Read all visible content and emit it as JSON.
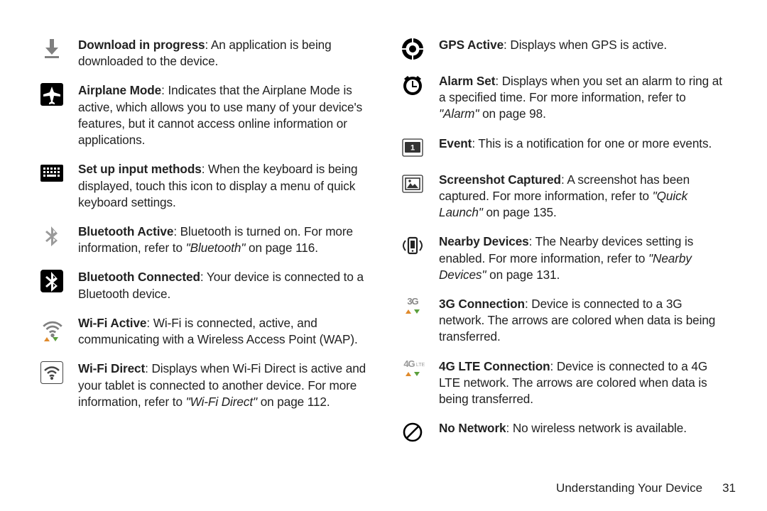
{
  "left": [
    {
      "icon": "download",
      "title": "Download in progress",
      "text": ": An application is being downloaded to the device."
    },
    {
      "icon": "airplane",
      "title": "Airplane Mode",
      "text": ": Indicates that the Airplane Mode is active, which allows you to use many of your device's features, but it cannot access online information or applications."
    },
    {
      "icon": "keyboard",
      "title": "Set up input methods",
      "text": ": When the keyboard is being displayed, touch this icon to display a menu of quick keyboard settings."
    },
    {
      "icon": "bt-off",
      "title": "Bluetooth Active",
      "text": ": Bluetooth is turned on. For more information, refer to ",
      "ref": "\"Bluetooth\"",
      "after": " on page 116."
    },
    {
      "icon": "bt-on",
      "title": "Bluetooth Connected",
      "text": ": Your device is connected to a Bluetooth device."
    },
    {
      "icon": "wifi",
      "title": "Wi-Fi Active",
      "text": ": Wi-Fi is connected, active, and communicating with a Wireless Access Point (WAP)."
    },
    {
      "icon": "wifidirect",
      "title": "Wi-Fi Direct",
      "text": ": Displays when Wi-Fi Direct is active and your tablet is connected to another device. For more information, refer to ",
      "ref": "\"Wi-Fi Direct\"",
      "after": " on page 112."
    }
  ],
  "right": [
    {
      "icon": "gps",
      "title": "GPS Active",
      "text": ": Displays when GPS is active."
    },
    {
      "icon": "alarm",
      "title": "Alarm Set",
      "text": ": Displays when you set an alarm to ring at a specified time. For more information, refer to ",
      "ref": "\"Alarm\"",
      "after": " on page 98."
    },
    {
      "icon": "event",
      "title": "Event",
      "text": ": This is a notification for one or more events."
    },
    {
      "icon": "screenshot",
      "title": "Screenshot Captured",
      "text": ": A screenshot has been captured. For more information, refer to ",
      "ref": "\"Quick Launch\"",
      "after": " on page 135."
    },
    {
      "icon": "nearby",
      "title": "Nearby Devices",
      "text": ": The Nearby devices setting is enabled. For more information, refer to ",
      "ref": "\"Nearby Devices\"",
      "after": " on page 131."
    },
    {
      "icon": "3g",
      "title": "3G Connection",
      "text": ": Device is connected to a 3G network. The arrows are colored when data is being transferred."
    },
    {
      "icon": "4g",
      "title": "4G LTE Connection",
      "text": ": Device is connected to a 4G LTE network. The arrows are colored when data is being transferred."
    },
    {
      "icon": "nonet",
      "title": "No Network",
      "text": ": No wireless network is available."
    }
  ],
  "footer": {
    "label": "Understanding Your Device",
    "page": "31"
  }
}
